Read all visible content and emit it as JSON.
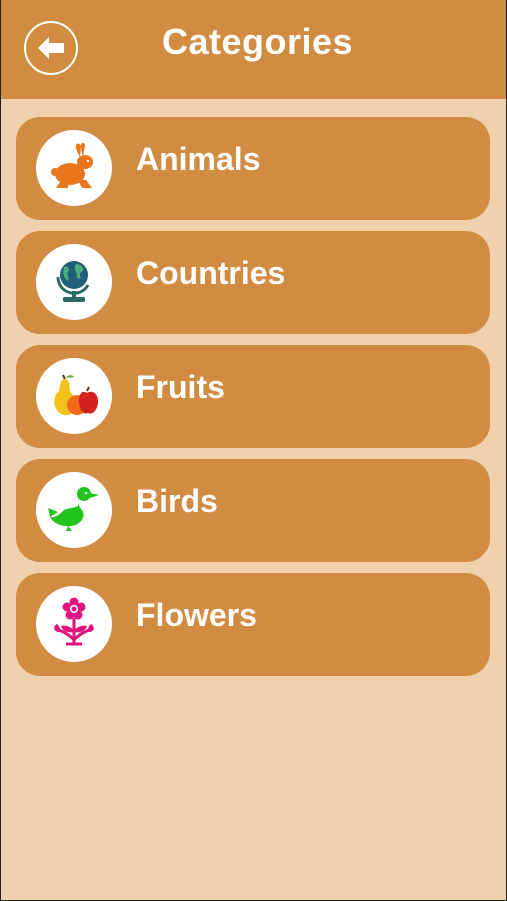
{
  "header": {
    "title": "Categories",
    "back_icon": "back-arrow-icon"
  },
  "categories": [
    {
      "label": "Animals",
      "icon": "rabbit-icon",
      "icon_color": "#e8761c"
    },
    {
      "label": "Countries",
      "icon": "globe-icon",
      "icon_color": "#1f5f7a"
    },
    {
      "label": "Fruits",
      "icon": "fruits-icon",
      "icon_color": "#e8a21c"
    },
    {
      "label": "Birds",
      "icon": "duck-icon",
      "icon_color": "#22c21f"
    },
    {
      "label": "Flowers",
      "icon": "flower-icon",
      "icon_color": "#e0147e"
    }
  ],
  "colors": {
    "background": "#efd1ae",
    "accent": "#d28c42",
    "text": "#ffffff"
  }
}
